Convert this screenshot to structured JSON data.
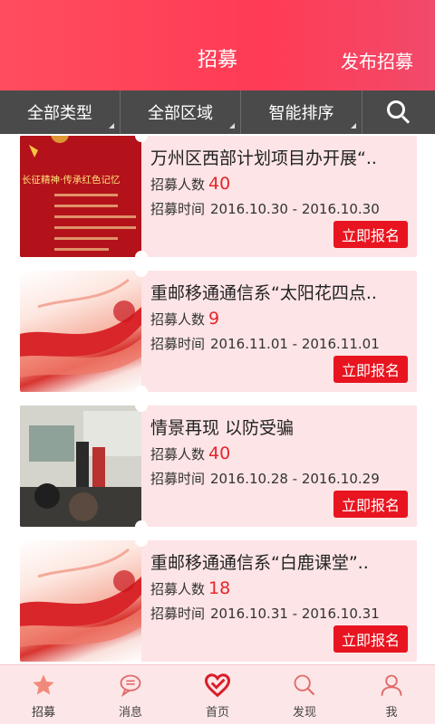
{
  "header": {
    "title": "招募",
    "publish_label": "发布招募"
  },
  "filters": {
    "type": "全部类型",
    "region": "全部区域",
    "sort": "智能排序",
    "search_icon": "search-icon"
  },
  "labels": {
    "count_label": "招募人数",
    "time_label": "招募时间",
    "signup": "立即报名"
  },
  "cards": [
    {
      "title": "万州区西部计划项目办开展“..",
      "count": "40",
      "dates": "2016.10.30 - 2016.10.30",
      "thumb": "red-poster"
    },
    {
      "title": "重邮移通通信系“太阳花四点..",
      "count": "9",
      "dates": "2016.11.01 - 2016.11.01",
      "thumb": "red-swoosh"
    },
    {
      "title": "情景再现 以防受骗",
      "count": "40",
      "dates": "2016.10.28 - 2016.10.29",
      "thumb": "classroom-photo"
    },
    {
      "title": "重邮移通通信系“白鹿课堂”..",
      "count": "18",
      "dates": "2016.10.31 - 2016.10.31",
      "thumb": "red-swoosh"
    }
  ],
  "poster_text": {
    "line1": "长征精神·传承红色记忆"
  },
  "tabs": [
    {
      "label": "招募",
      "icon": "star-icon",
      "active": true
    },
    {
      "label": "消息",
      "icon": "chat-bubble-icon",
      "active": false
    },
    {
      "label": "首页",
      "icon": "heart-icon",
      "active": false
    },
    {
      "label": "发现",
      "icon": "search-icon",
      "active": false
    },
    {
      "label": "我",
      "icon": "person-icon",
      "active": false
    }
  ],
  "colors": {
    "header": "#ff4d5e",
    "accent": "#e8141f",
    "card_bg": "#fde4e6",
    "filter_bg": "#4a4a4a",
    "star": "#f08a7a"
  }
}
